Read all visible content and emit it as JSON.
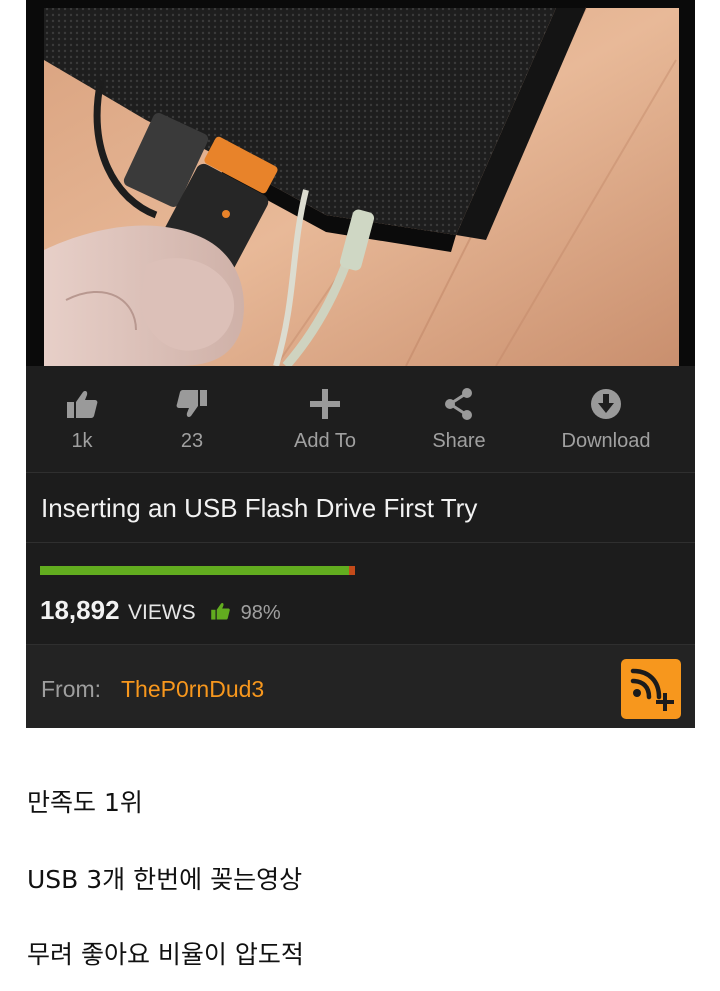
{
  "video": {
    "title": "Inserting an USB Flash Drive First Try"
  },
  "actions": {
    "like_count": "1k",
    "dislike_count": "23",
    "add_to_label": "Add To",
    "share_label": "Share",
    "download_label": "Download"
  },
  "stats": {
    "views_count": "18,892",
    "views_word": "VIEWS",
    "rating_percent": "98%",
    "rating_fraction": 0.98
  },
  "uploader": {
    "from_label": "From:",
    "name": "TheP0rnDud3"
  },
  "captions": [
    "만족도 1위",
    "USB 3개 한번에 꽂는영상",
    "무려 좋아요 비율이 압도적"
  ],
  "colors": {
    "accent_orange": "#f7971d",
    "rating_green": "#62ac1f",
    "rating_red": "#c44b1a",
    "card_background": "#1b1b1b"
  },
  "icons": {
    "like": "thumbs-up-icon",
    "dislike": "thumbs-down-icon",
    "add": "plus-icon",
    "share": "share-icon",
    "download": "download-icon",
    "subscribe": "rss-plus-icon"
  }
}
